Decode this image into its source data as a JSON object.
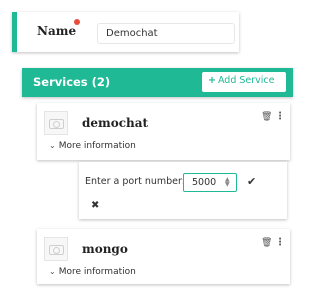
{
  "name_section": {
    "label": "Name",
    "required_color": "#e74c3c",
    "value": "Demochat"
  },
  "services": {
    "title": "Services (2)",
    "add_button_label": "Add Service",
    "accent_color": "#20b996",
    "items": [
      {
        "name": "demochat",
        "more_label": "More information",
        "avatar_icon": "camera-icon"
      },
      {
        "name": "mongo",
        "more_label": "More information",
        "avatar_icon": "camera-icon"
      }
    ]
  },
  "port_editor": {
    "label": "Enter a port number:",
    "value": "5000",
    "confirm_icon": "check-icon",
    "cancel_icon": "close-icon"
  },
  "icons": {
    "trash": "trash-icon",
    "menu": "kebab-menu-icon",
    "chevron": "chevron-down-icon"
  }
}
